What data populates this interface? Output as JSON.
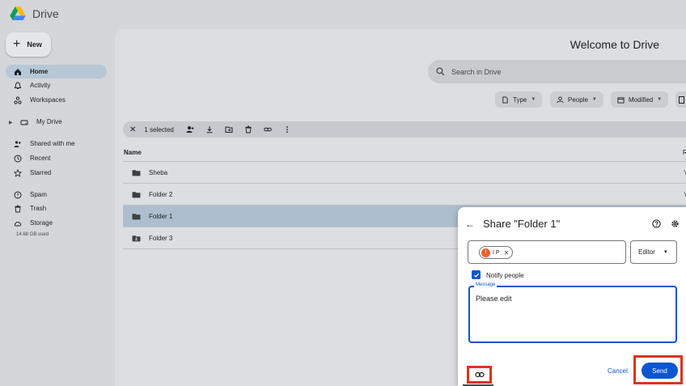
{
  "app": {
    "name": "Drive"
  },
  "new_button": {
    "label": "New"
  },
  "sidebar": {
    "items": [
      {
        "label": "Home",
        "icon": "home-icon"
      },
      {
        "label": "Activity",
        "icon": "bell-icon"
      },
      {
        "label": "Workspaces",
        "icon": "workspaces-icon"
      },
      {
        "label": "My Drive",
        "icon": "drive-icon"
      },
      {
        "label": "Shared with me",
        "icon": "people-icon"
      },
      {
        "label": "Recent",
        "icon": "clock-icon"
      },
      {
        "label": "Starred",
        "icon": "star-icon"
      },
      {
        "label": "Spam",
        "icon": "spam-icon"
      },
      {
        "label": "Trash",
        "icon": "trash-icon"
      },
      {
        "label": "Storage",
        "icon": "cloud-icon"
      }
    ],
    "storage_used": "14.68 GB used"
  },
  "main": {
    "title": "Welcome to Drive",
    "search_placeholder": "Search in Drive",
    "filters": [
      {
        "label": "Type"
      },
      {
        "label": "People"
      },
      {
        "label": "Modified"
      }
    ],
    "selection_bar": {
      "count_label": "1 selected"
    },
    "table": {
      "column_name": "Name",
      "column_right": "R",
      "rows": [
        {
          "name": "Sheba",
          "right": "Y"
        },
        {
          "name": "Folder 2",
          "right": "Y"
        },
        {
          "name": "Folder 1",
          "right": "",
          "selected": true
        },
        {
          "name": "Folder 3",
          "right": ""
        }
      ]
    }
  },
  "share_dialog": {
    "title": "Share \"Folder 1\"",
    "person": {
      "initial": "I",
      "label": "I P"
    },
    "role": "Editor",
    "notify_label": "Notify people",
    "notify_checked": true,
    "message_label": "Message",
    "message_text": "Please edit",
    "cancel_label": "Cancel",
    "send_label": "Send"
  },
  "colors": {
    "accent": "#0b57d0",
    "highlight": "#e0321c",
    "selected_row": "#adbfce",
    "avatar": "#e8622c"
  }
}
